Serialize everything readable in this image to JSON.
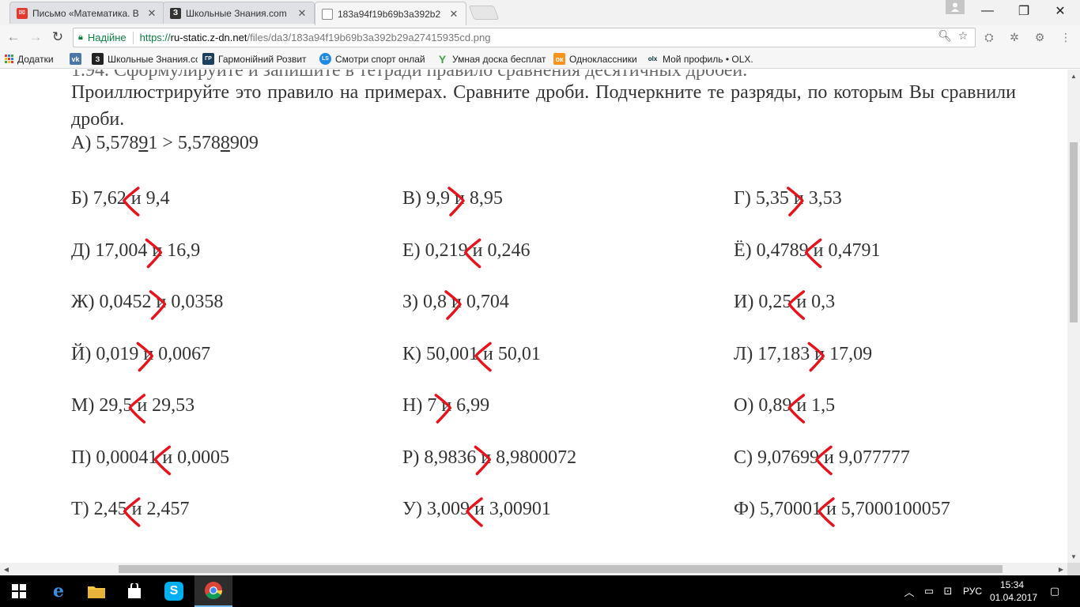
{
  "browser": {
    "tabs": [
      {
        "title": "Письмо «Математика. В",
        "icon": "mail-icon",
        "color": "#e23b2e"
      },
      {
        "title": "Школьные Знания.com",
        "icon": "znanija-icon",
        "color": "#333333"
      },
      {
        "title": "183a94f19b69b3a392b2",
        "icon": "page-icon",
        "color": "#ffffff"
      }
    ],
    "address": {
      "secure_label": "Надійне",
      "scheme": "https://",
      "host": "ru-static.z-dn.net",
      "path": "/files/da3/183a94f19b69b3a392b29a27415935cd.png"
    },
    "bookmarks": [
      {
        "label": "Додатки",
        "icon": "apps-icon",
        "color": "#4285f4"
      },
      {
        "label": "",
        "icon": "vk-icon",
        "color": "#4a76a8"
      },
      {
        "label": "Школьные Знания.сс",
        "icon": "znanija-icon",
        "color": "#222222"
      },
      {
        "label": "Гармонійний Розвит",
        "icon": "gr-icon",
        "color": "#1c3f5f"
      },
      {
        "label": "Смотри спорт онлай",
        "icon": "sport-icon",
        "color": "#1e88e5"
      },
      {
        "label": "Умная доска бесплат",
        "icon": "board-icon",
        "color": "#43a047"
      },
      {
        "label": "Одноклассники",
        "icon": "ok-icon",
        "color": "#f7931e"
      },
      {
        "label": "Мой профиль • OLX.",
        "icon": "olx-icon",
        "color": "#002f34"
      }
    ]
  },
  "document": {
    "intro_cut": "1.94. Сформулируйте и запишите в тетради правило сравнения десятичных дробей.",
    "intro": "Проиллюстрируйте это правило на примерах. Сравните дроби. Подчеркните те разряды, по которым Вы сравнили дроби.",
    "example_prefix": "А) 5,578",
    "example_u1": "9",
    "example_mid": "1 > 5,578",
    "example_u2": "8",
    "example_suffix": "909",
    "problems": [
      {
        "text": "Б) 7,62 и 9,4",
        "mark": "<"
      },
      {
        "text": "В) 9,9 и 8,95",
        "mark": ">"
      },
      {
        "text": "Г) 5,35 и 3,53",
        "mark": ">"
      },
      {
        "text": "Д) 17,004 и 16,9",
        "mark": ">"
      },
      {
        "text": "Е) 0,219 и 0,246",
        "mark": "<"
      },
      {
        "text": "Ё) 0,4789 и 0,4791",
        "mark": "<"
      },
      {
        "text": "Ж) 0,0452 и 0,0358",
        "mark": ">"
      },
      {
        "text": "З) 0,8 и 0,704",
        "mark": ">"
      },
      {
        "text": "И) 0,25 и 0,3",
        "mark": "<"
      },
      {
        "text": "Й) 0,019 и 0,0067",
        "mark": ">"
      },
      {
        "text": "К) 50,001 и 50,01",
        "mark": "<"
      },
      {
        "text": "Л) 17,183 и 17,09",
        "mark": ">"
      },
      {
        "text": "М) 29,5 и 29,53",
        "mark": "<"
      },
      {
        "text": "Н) 7 и 6,99",
        "mark": ">"
      },
      {
        "text": "О) 0,89 и 1,5",
        "mark": "<"
      },
      {
        "text": "П) 0,00041 и 0,0005",
        "mark": "<"
      },
      {
        "text": "Р) 8,9836 и 8,9800072",
        "mark": ">"
      },
      {
        "text": "С) 9,07699 и 9,077777",
        "mark": "<"
      },
      {
        "text": "Т) 2,45 и 2,457",
        "mark": "<"
      },
      {
        "text": "У) 3,009 и 3,00901",
        "mark": "<"
      },
      {
        "text": "Ф) 5,70001 и 5,7000100057",
        "mark": "<"
      }
    ],
    "mark_color": "#e8121c"
  },
  "taskbar": {
    "language": "РУС",
    "time": "15:34",
    "date": "01.04.2017",
    "apps": [
      "windows-icon",
      "edge-icon",
      "explorer-icon",
      "store-icon",
      "skype-icon",
      "chrome-icon"
    ]
  }
}
